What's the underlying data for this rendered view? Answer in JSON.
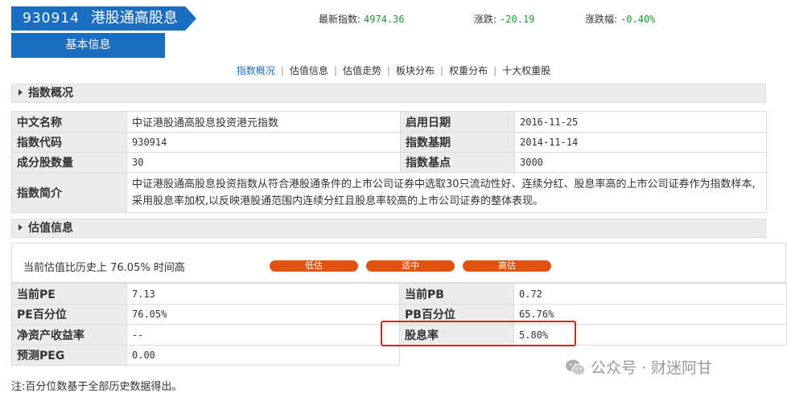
{
  "header": {
    "code": "930914",
    "name": "港股通高股息",
    "basic_info": "基本信息",
    "latest_label": "最新指数:",
    "latest_value": "4974.36",
    "change_label": "涨跌:",
    "change_value": "-20.19",
    "change_pct_label": "涨跌幅:",
    "change_pct_value": "-0.40%"
  },
  "nav": {
    "items": [
      "指数概况",
      "估值信息",
      "估值走势",
      "板块分布",
      "权重分布",
      "十大权重股"
    ],
    "active": "指数概况"
  },
  "overview": {
    "title": "指数概况",
    "rows": [
      {
        "l1": "中文名称",
        "v1": "中证港股通高股息投资港元指数",
        "l2": "启用日期",
        "v2": "2016-11-25"
      },
      {
        "l1": "指数代码",
        "v1": "930914",
        "l2": "指数基期",
        "v2": "2014-11-14"
      },
      {
        "l1": "成分股数量",
        "v1": "30",
        "l2": "指数基点",
        "v2": "3000"
      }
    ],
    "intro_label": "指数简介",
    "intro_text": "中证港股通高股息投资指数从符合港股通条件的上市公司证券中选取30只流动性好、连续分红、股息率高的上市公司证券作为指数样本,采用股息率加权,以反映港股通范围内连续分红且股息率较高的上市公司证券的整体表现。"
  },
  "valuation": {
    "title": "估值信息",
    "summary": "当前估值比历史上 76.05% 时间高",
    "levels": [
      "低估",
      "适中",
      "高估"
    ],
    "rows": [
      {
        "l1": "当前PE",
        "v1": "7.13",
        "l2": "当前PB",
        "v2": "0.72"
      },
      {
        "l1": "PE百分位",
        "v1": "76.05%",
        "l2": "PB百分位",
        "v2": "65.76%"
      },
      {
        "l1": "净资产收益率",
        "v1": "--",
        "l2": "股息率",
        "v2": "5.80%"
      },
      {
        "l1": "预测PEG",
        "v1": "0.00"
      }
    ]
  },
  "note": "注:百分位数基于全部历史数据得出。",
  "watermark": "公众号 · 财迷阿甘",
  "colors": {
    "brand": "#1a6ec2",
    "change": "#199c2c",
    "pill": "#e2520f",
    "highlight": "#e02020"
  }
}
